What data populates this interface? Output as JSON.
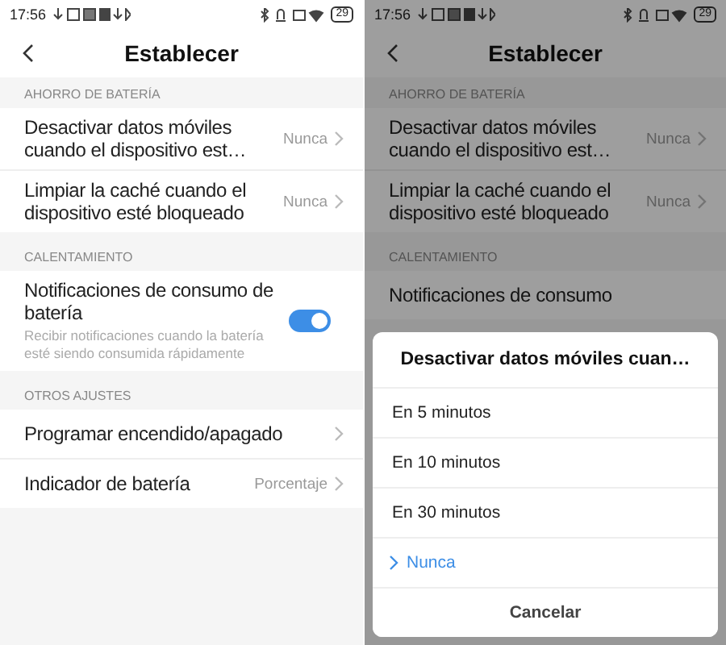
{
  "screens": [
    {
      "status_bar": {
        "time": "17:56",
        "battery": "29"
      },
      "header": {
        "title": "Establecer"
      },
      "sections": [
        {
          "title": "AHORRO DE BATERÍA",
          "items": [
            {
              "kind": "value",
              "title": "Desactivar datos móviles cuando el dispositivo est…",
              "value": "Nunca"
            },
            {
              "kind": "value",
              "title": "Limpiar la caché cuando el dispositivo esté bloqueado",
              "value": "Nunca"
            }
          ]
        },
        {
          "title": "CALENTAMIENTO",
          "items": [
            {
              "kind": "toggle",
              "title": "Notificaciones de consumo de batería",
              "subtitle": "Recibir notificaciones cuando la batería esté siendo consumida rápidamente",
              "on": true
            }
          ]
        },
        {
          "title": "OTROS AJUSTES",
          "items": [
            {
              "kind": "link",
              "title": "Programar encendido/apagado"
            },
            {
              "kind": "value",
              "title": "Indicador de batería",
              "value": "Porcentaje"
            }
          ]
        }
      ]
    },
    {
      "status_bar": {
        "time": "17:56",
        "battery": "29"
      },
      "header": {
        "title": "Establecer"
      },
      "sections": [
        {
          "title": "AHORRO DE BATERÍA",
          "items": [
            {
              "kind": "value",
              "title": "Desactivar datos móviles cuando el dispositivo est…",
              "value": "Nunca"
            },
            {
              "kind": "value",
              "title": "Limpiar la caché cuando el dispositivo esté bloqueado",
              "value": "Nunca"
            }
          ]
        },
        {
          "title": "CALENTAMIENTO",
          "items": [
            {
              "kind": "link_plain",
              "title": "Notificaciones de consumo"
            }
          ]
        }
      ],
      "dialog": {
        "title": "Desactivar datos móviles cuan…",
        "options": [
          {
            "label": "En 5 minutos",
            "selected": false
          },
          {
            "label": "En 10 minutos",
            "selected": false
          },
          {
            "label": "En 30 minutos",
            "selected": false
          },
          {
            "label": "Nunca",
            "selected": true
          }
        ],
        "cancel": "Cancelar"
      }
    }
  ]
}
